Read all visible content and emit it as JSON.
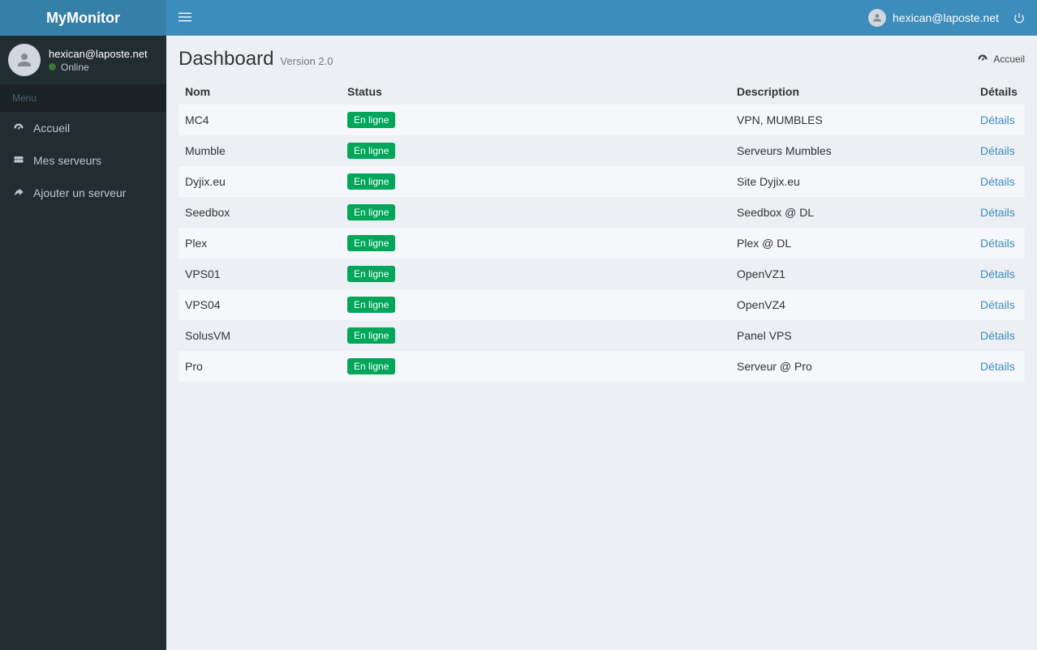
{
  "brand": "MyMonitor",
  "header": {
    "user_email": "hexican@laposte.net"
  },
  "sidebar": {
    "user_email": "hexican@laposte.net",
    "status_label": "Online",
    "menu_header": "Menu",
    "items": [
      {
        "label": "Accueil"
      },
      {
        "label": "Mes serveurs"
      },
      {
        "label": "Ajouter un serveur"
      }
    ]
  },
  "page": {
    "title": "Dashboard",
    "subtitle": "Version 2.0",
    "breadcrumb": "Accueil"
  },
  "table": {
    "headers": {
      "name": "Nom",
      "status": "Status",
      "description": "Description",
      "details": "Détails"
    },
    "status_badge": "En ligne",
    "details_label": "Détails",
    "rows": [
      {
        "name": "MC4",
        "description": "VPN, MUMBLES"
      },
      {
        "name": "Mumble",
        "description": "Serveurs Mumbles"
      },
      {
        "name": "Dyjix.eu",
        "description": "Site Dyjix.eu"
      },
      {
        "name": "Seedbox",
        "description": "Seedbox @ DL"
      },
      {
        "name": "Plex",
        "description": "Plex @ DL"
      },
      {
        "name": "VPS01",
        "description": "OpenVZ1"
      },
      {
        "name": "VPS04",
        "description": "OpenVZ4"
      },
      {
        "name": "SolusVM",
        "description": "Panel VPS"
      },
      {
        "name": "Pro",
        "description": "Serveur @ Pro"
      }
    ]
  }
}
